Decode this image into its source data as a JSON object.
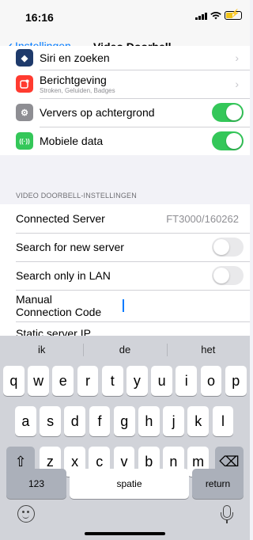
{
  "status": {
    "time": "16:16"
  },
  "nav": {
    "back_label": "Instellingen",
    "title": "Video Doorbell"
  },
  "apps": [
    {
      "label": "Siri en zoeken",
      "icon": "siri-icon",
      "color": "#1e3a6b"
    },
    {
      "label": "Berichtgeving",
      "sub": "Stroken, Geluiden, Badges",
      "icon": "notifications-icon",
      "color": "#ff3b30"
    },
    {
      "label": "Ververs op achtergrond",
      "icon": "gear-icon",
      "color": "#8e8e93",
      "toggle": true
    },
    {
      "label": "Mobiele data",
      "icon": "antenna-icon",
      "color": "#34c759",
      "toggle": true
    }
  ],
  "section": {
    "header": "VIDEO DOORBELL-INSTELLINGEN",
    "connected_server_label": "Connected Server",
    "connected_server_value": "FT3000/160262",
    "search_new_label": "Search for new server",
    "search_new_on": false,
    "search_lan_label": "Search only in LAN",
    "search_lan_on": false,
    "manual_code_label": "Manual Connection Code",
    "static_ip_label": "Static server IP"
  },
  "keyboard": {
    "suggestions": [
      "ik",
      "de",
      "het"
    ],
    "row1": [
      "q",
      "w",
      "e",
      "r",
      "t",
      "y",
      "u",
      "i",
      "o",
      "p"
    ],
    "row2": [
      "a",
      "s",
      "d",
      "f",
      "g",
      "h",
      "j",
      "k",
      "l"
    ],
    "row3": [
      "z",
      "x",
      "c",
      "v",
      "b",
      "n",
      "m"
    ],
    "numbers_label": "123",
    "space_label": "spatie",
    "return_label": "return",
    "shift_glyph": "⇧",
    "delete_glyph": "⌫"
  }
}
